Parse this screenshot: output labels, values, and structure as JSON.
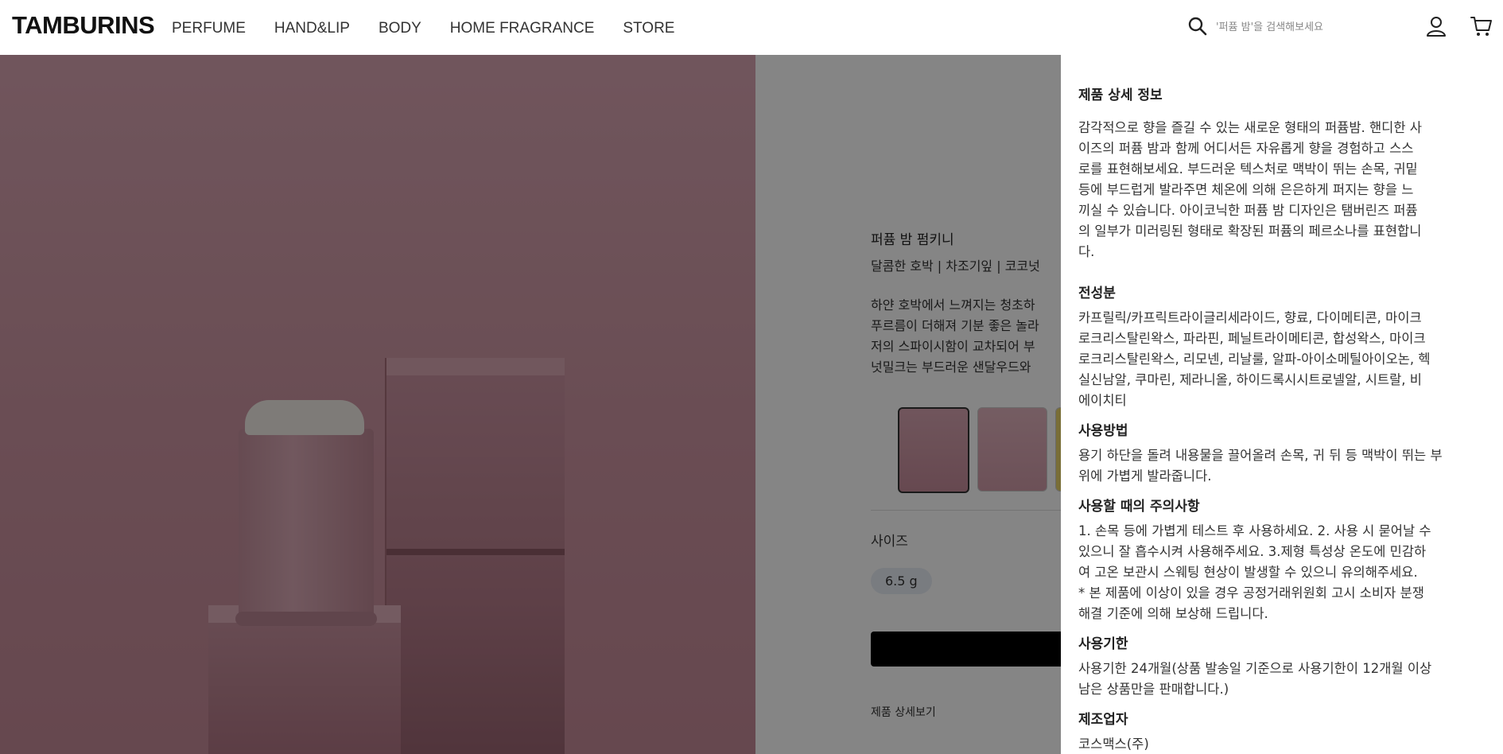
{
  "header": {
    "logo": "TAMBURINS",
    "nav": [
      "PERFUME",
      "HAND&LIP",
      "BODY",
      "HOME FRAGRANCE",
      "STORE"
    ],
    "search_placeholder": "'퍼퓸 밤'을 검색해보세요"
  },
  "icons": {
    "search": "search-icon",
    "user": "user-icon",
    "cart": "cart-icon"
  },
  "product": {
    "name": "퍼퓸 밤 펌키니",
    "notes": "달콤한 호박 | 차조기잎 | 코코넛",
    "desc_lines": [
      "하얀 호박에서 느껴지는 청초하",
      "푸르름이 더해져 기분 좋은 놀라",
      "저의 스파이시함이 교차되어 부",
      "넛밀크는 부드러운 샌달우드와"
    ],
    "size_label": "사이즈",
    "size_value": "6.5 g",
    "detail_link": "제품 상세보기"
  },
  "drawer": {
    "sections": [
      {
        "title": "제품 상세 정보",
        "lines": [
          "감각적으로 향을 즐길 수 있는 새로운 형태의 퍼퓸밤. 핸디한 사",
          "이즈의 퍼퓸 밤과 함께 어디서든 자유롭게 향을 경험하고 스스",
          "로를 표현해보세요. 부드러운 텍스처로 맥박이 뛰는 손목, 귀밑",
          "등에 부드럽게 발라주면 체온에 의해 은은하게 퍼지는 향을 느",
          "끼실 수 있습니다. 아이코닉한 퍼퓸 밤 디자인은 탬버린즈 퍼퓸",
          "의 일부가 미러링된 형태로 확장된 퍼퓸의 페르소나를 표현합니",
          "다."
        ]
      },
      {
        "title": "전성분",
        "lines": [
          "카프릴릭/카프릭트라이글리세라이드, 향료, 다이메티콘, 마이크",
          "로크리스탈린왁스, 파라핀, 페닐트라이메티콘, 합성왁스, 마이크",
          "로크리스탈린왁스, 리모넨, 리날룰, 알파-아이소메틸아이오논, 헥",
          "실신남알, 쿠마린, 제라니올, 하이드록시시트로넬알, 시트랄, 비",
          "에이치티"
        ]
      },
      {
        "title": "사용방법",
        "lines": [
          "용기 하단을 돌려 내용물을 끌어올려 손목, 귀 뒤 등 맥박이 뛰는 부",
          "위에 가볍게 발라줍니다."
        ]
      },
      {
        "title": "사용할 때의 주의사항",
        "lines": [
          "1. 손목 등에 가볍게 테스트 후 사용하세요. 2. 사용 시 묻어날 수",
          "있으니 잘 흡수시켜 사용해주세요. 3.제형 특성상 온도에 민감하",
          "여 고온 보관시 스웨팅 현상이 발생할 수 있으니 유의해주세요.",
          "* 본 제품에 이상이 있을 경우 공정거래위원회 고시 소비자 분쟁",
          "해결 기준에 의해 보상해 드립니다."
        ]
      },
      {
        "title": "사용기한",
        "lines": [
          "사용기한 24개월(상품 발송일 기준으로 사용기한이 12개월 이상",
          "남은 상품만을 판매합니다.)"
        ]
      },
      {
        "title": "제조업자",
        "lines": [
          "코스맥스(주)"
        ]
      }
    ]
  }
}
